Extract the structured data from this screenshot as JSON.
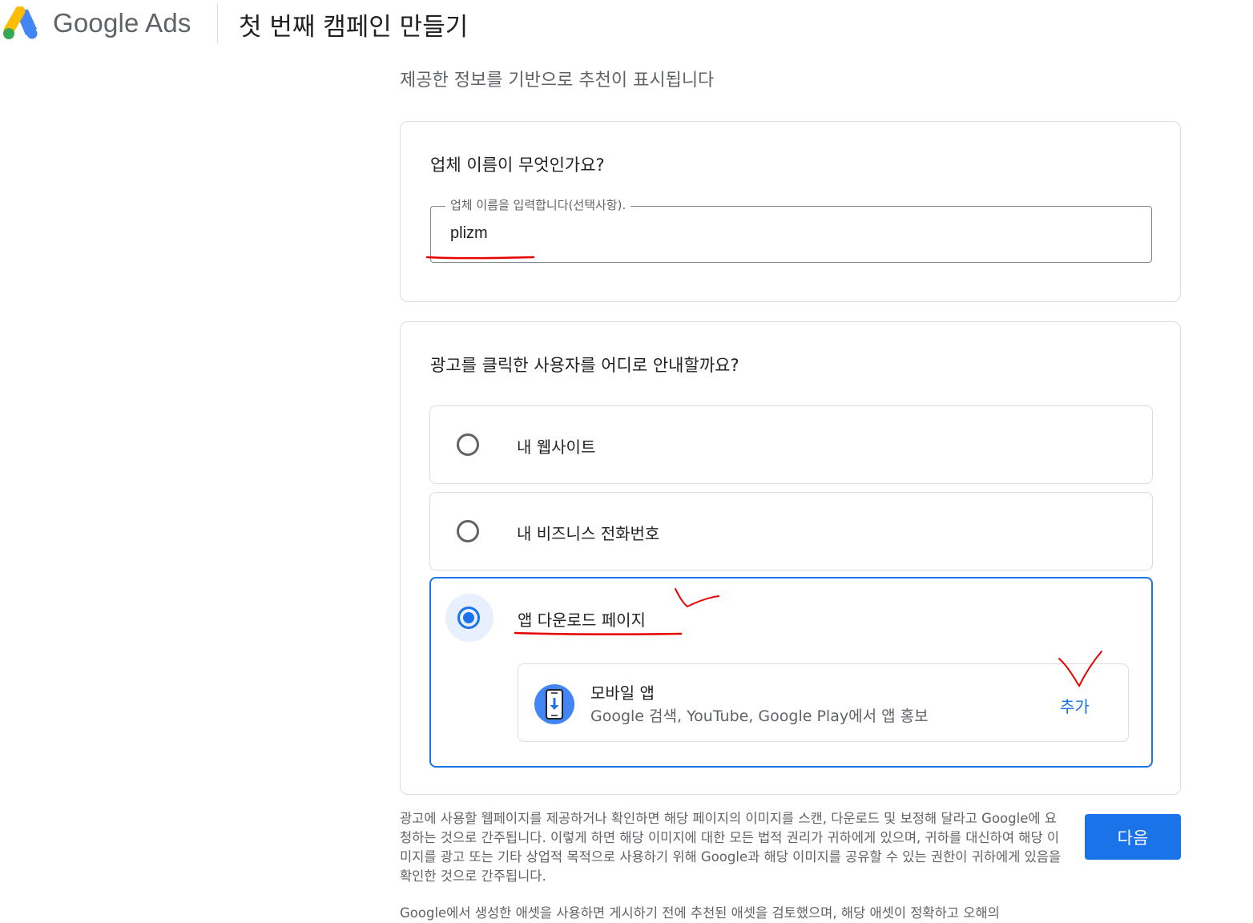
{
  "header": {
    "brand": "Google Ads",
    "page_title": "첫 번째 캠페인 만들기"
  },
  "subtitle": "제공한 정보를 기반으로 추천이 표시됩니다",
  "business_card": {
    "title": "업체 이름이 무엇인가요?",
    "field_label": "업체 이름을 입력합니다(선택사항).",
    "field_value": "plizm"
  },
  "destination_card": {
    "title": "광고를 클릭한 사용자를 어디로 안내할까요?",
    "options": [
      {
        "label": "내 웹사이트",
        "selected": false
      },
      {
        "label": "내 비즈니스 전화번호",
        "selected": false
      },
      {
        "label": "앱 다운로드 페이지",
        "selected": true
      }
    ],
    "app_option": {
      "title": "모바일 앱",
      "description": "Google 검색, YouTube, Google Play에서 앱 홍보",
      "add_label": "추가"
    }
  },
  "disclaimer": "광고에 사용할 웹페이지를 제공하거나 확인하면 해당 페이지의 이미지를 스캔, 다운로드 및 보정해 달라고 Google에 요청하는 것으로 간주됩니다. 이렇게 하면 해당 이미지에 대한 모든 법적 권리가 귀하에게 있으며, 귀하를 대신하여 해당 이미지를 광고 또는 기타 상업적 목적으로 사용하기 위해 Google과 해당 이미지를 공유할 수 있는 권한이 귀하에게 있음을 확인한 것으로 간주됩니다.",
  "disclaimer2": "Google에서 생성한 애셋을 사용하면 게시하기 전에 추천된 애셋을 검토했으며, 해당 애셋이 정확하고 오해의",
  "next_label": "다음",
  "colors": {
    "accent": "#1a73e8",
    "annotation": "#e60000",
    "logo_blue": "#4285f4",
    "logo_yellow": "#fbbc04",
    "logo_green": "#34a853"
  },
  "icons": {
    "logo": "google-ads-logo",
    "app": "mobile-download-icon"
  }
}
